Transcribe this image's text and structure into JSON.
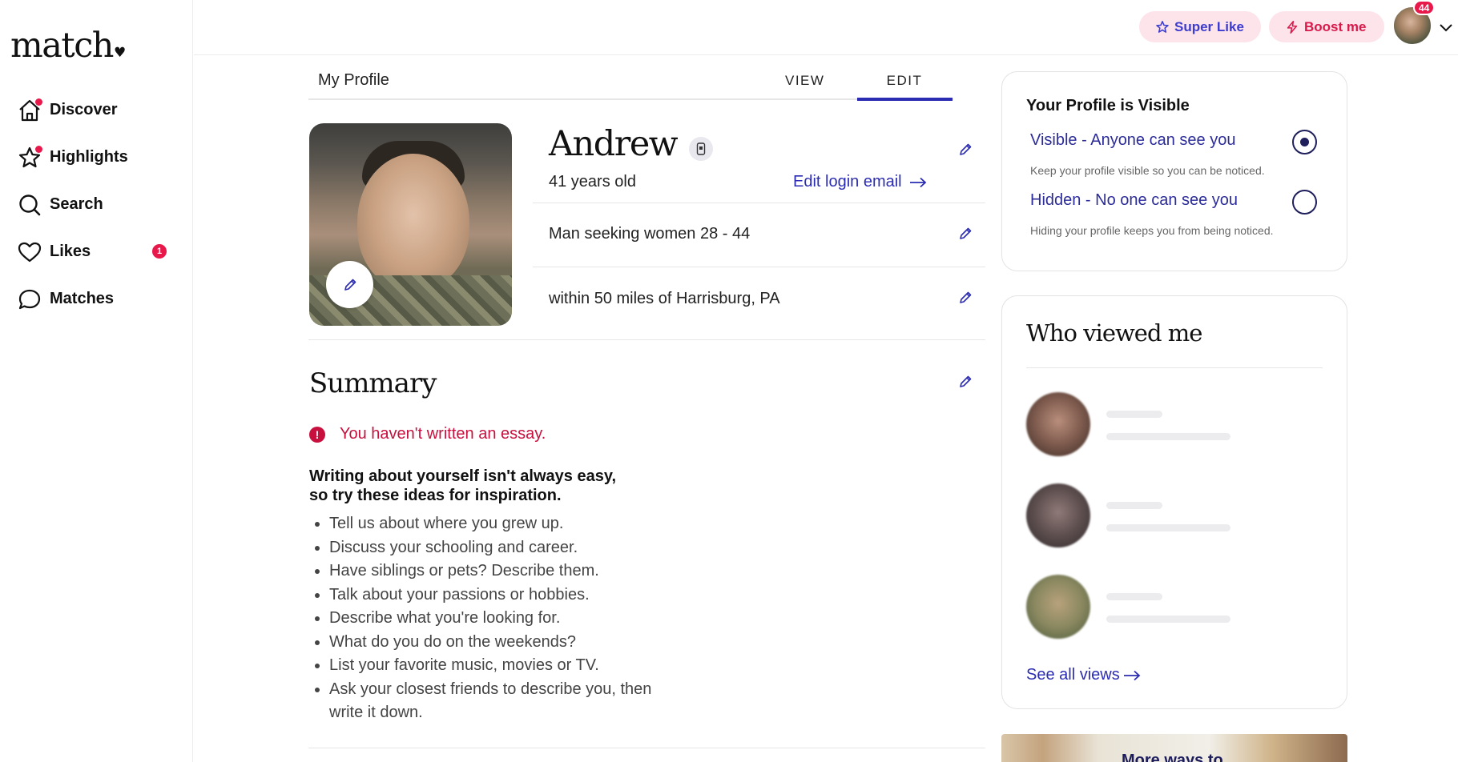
{
  "brand": {
    "logo": "match",
    "logo_mark": "♥"
  },
  "sidebar": {
    "items": [
      {
        "label": "Discover",
        "icon": "home-icon"
      },
      {
        "label": "Highlights",
        "icon": "star-icon"
      },
      {
        "label": "Search",
        "icon": "search-icon"
      },
      {
        "label": "Likes",
        "icon": "heart-icon",
        "badge": "1"
      },
      {
        "label": "Matches",
        "icon": "chat-bubble-icon"
      }
    ]
  },
  "topbar": {
    "super_like": "Super Like",
    "boost": "Boost me",
    "notifications": "44"
  },
  "profile": {
    "header_title": "My Profile",
    "tabs": {
      "view": "VIEW",
      "edit": "EDIT",
      "active": "EDIT"
    },
    "name": "Andrew",
    "age": "41 years old",
    "edit_login_email": "Edit login email",
    "seeking": "Man seeking women 28 - 44",
    "location": "within 50 miles of Harrisburg, PA"
  },
  "summary": {
    "title": "Summary",
    "warning": "You haven't written an essay.",
    "tips_heading_line1": "Writing about yourself isn't always easy,",
    "tips_heading_line2": "so try these ideas for inspiration.",
    "tips": [
      "Tell us about where you grew up.",
      "Discuss your schooling and career.",
      "Have siblings or pets? Describe them.",
      "Talk about your passions or hobbies.",
      "Describe what you're looking for.",
      "What do you do on the weekends?",
      "List your favorite music, movies or TV.",
      "Ask your closest friends to describe you, then write it down."
    ]
  },
  "visibility": {
    "title": "Your Profile is Visible",
    "visible_option": "Visible - Anyone can see you",
    "visible_sub": "Keep your profile visible so you can be noticed.",
    "hidden_option": "Hidden - No one can see you",
    "hidden_sub": "Hiding your profile keeps you from being noticed.",
    "selected": "visible"
  },
  "viewed": {
    "title": "Who viewed me",
    "see_all": "See all views"
  },
  "promo": {
    "text": "More ways to"
  },
  "colors": {
    "accent": "#2c2cb3",
    "brand_red": "#e8184b",
    "warning": "#c8103e",
    "pill_bg": "#fde3ea"
  }
}
